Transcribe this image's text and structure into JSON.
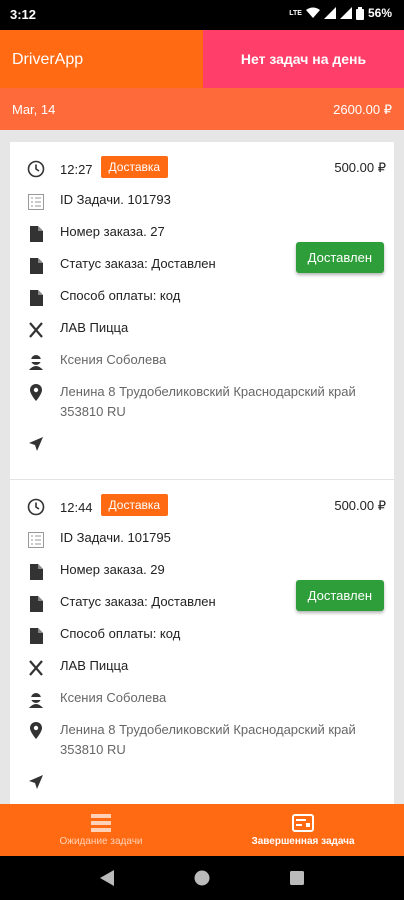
{
  "status_bar": {
    "time": "3:12",
    "network": "LTE",
    "battery": "56%"
  },
  "app_bar": {
    "title": "DriverApp",
    "notice": "Нет задач на день"
  },
  "summary": {
    "date": "Mar, 14",
    "total": "2600.00 ₽"
  },
  "tasks": [
    {
      "time": "12:27",
      "type": "Доставка",
      "price": "500.00 ₽",
      "task_id": "ID Задачи. 101793",
      "order_number": "Номер заказа. 27",
      "order_status": "Статус заказа: Доставлен",
      "payment": "Способ оплаты: код",
      "restaurant": "ЛАВ Пицца",
      "customer": "Ксения Соболева",
      "address": "Ленина 8 Трудобеликовский Краснодарский край 353810 RU",
      "status_button": "Доставлен"
    },
    {
      "time": "12:44",
      "type": "Доставка",
      "price": "500.00 ₽",
      "task_id": "ID Задачи. 101795",
      "order_number": "Номер заказа. 29",
      "order_status": "Статус заказа: Доставлен",
      "payment": "Способ оплаты: код",
      "restaurant": "ЛАВ Пицца",
      "customer": "Ксения Соболева",
      "address": "Ленина 8 Трудобеликовский Краснодарский край 353810 RU",
      "status_button": "Доставлен"
    }
  ],
  "bottom_nav": {
    "tabs": [
      {
        "label": "Ожидание задачи",
        "icon": "list-icon",
        "active": false
      },
      {
        "label": "Завершенная задача",
        "icon": "completed-task-icon",
        "active": true
      }
    ]
  },
  "colors": {
    "primary": "#ff6a13",
    "notice": "#ff3f6a",
    "success": "#2e9e3a"
  }
}
